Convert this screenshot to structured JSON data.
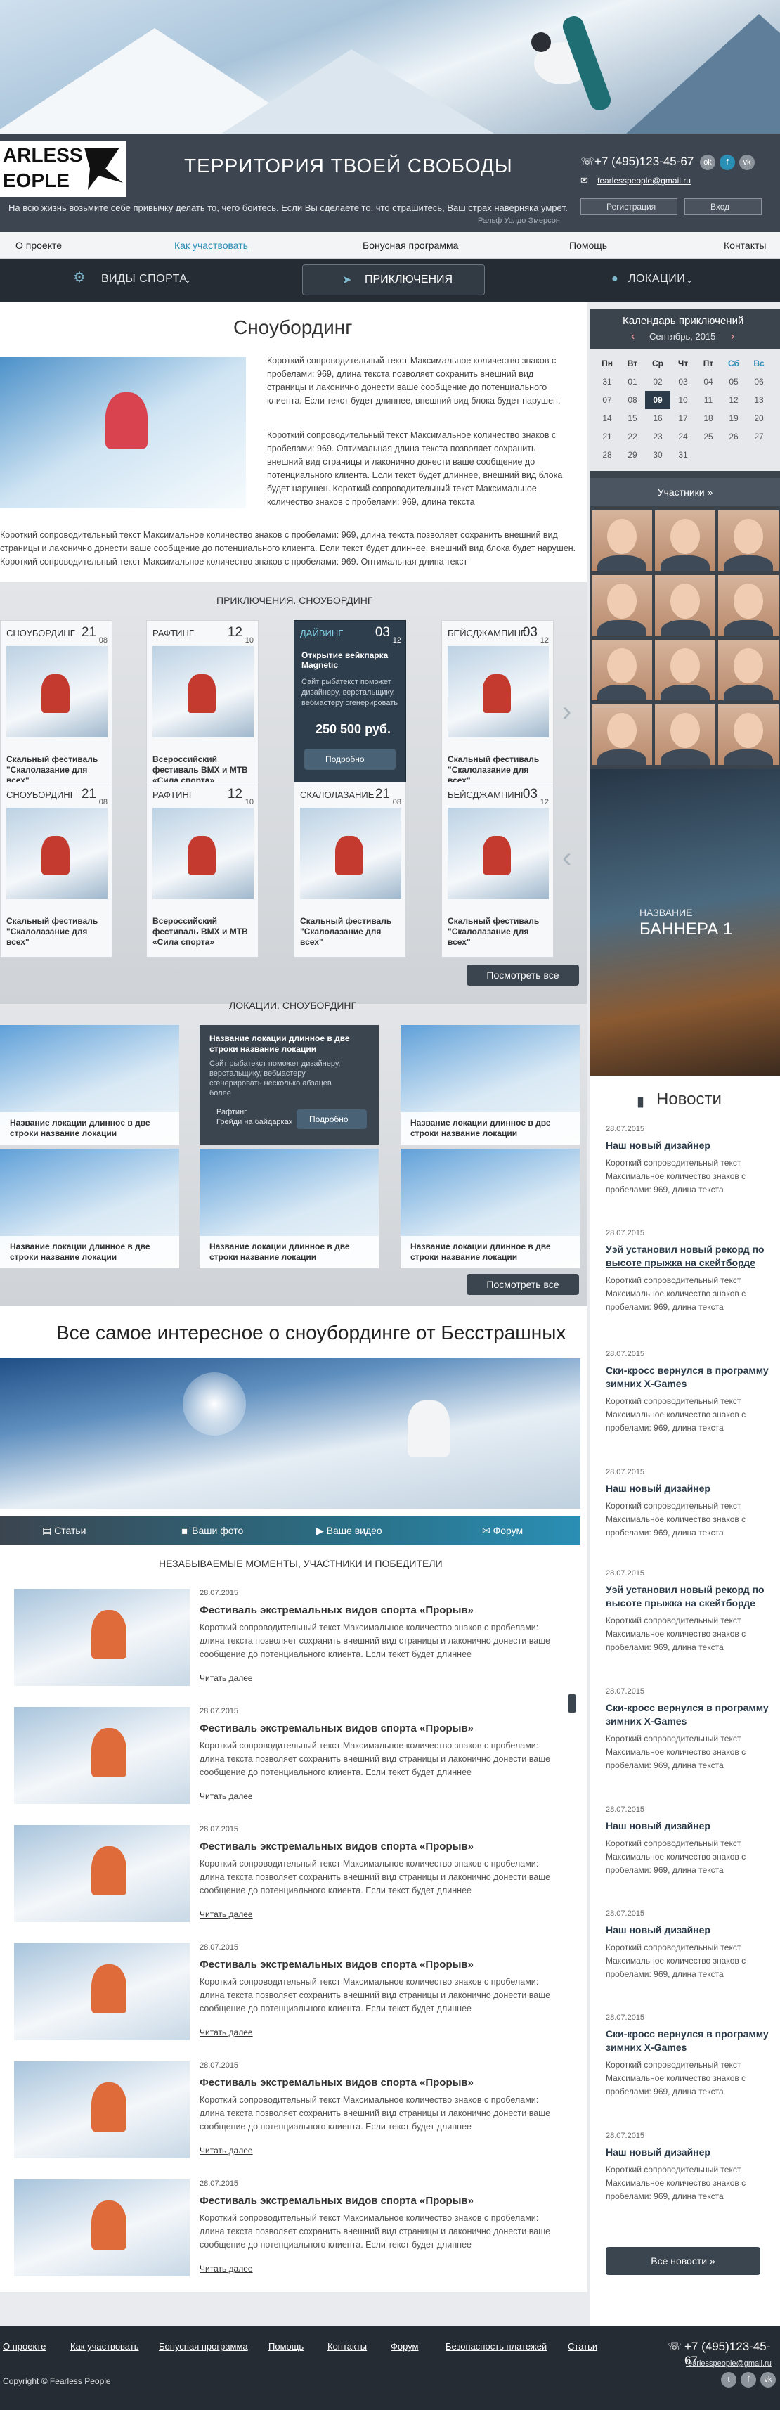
{
  "header": {
    "logo_text": "FEARLESS PEOPLE",
    "slogan": "ТЕРРИТОРИЯ ТВОЕЙ СВОБОДЫ",
    "quote": "На всю жизнь возьмите себе привычку делать то, чего боитесь. Если Вы сделаете то, что страшитесь, Ваш страх наверняка умрёт.",
    "quote_author": "Ральф Уолдо Эмерсон",
    "phone": "+7 (495)123-45-67",
    "email": "fearlesspeople@gmail.ru",
    "register_label": "Регистрация",
    "login_label": "Вход",
    "social": [
      "ok",
      "f",
      "vk"
    ]
  },
  "topnav": [
    "О проекте",
    "Как участвовать",
    "Бонусная программа",
    "Помощь",
    "Контакты"
  ],
  "mainnav": {
    "sports": "ВИДЫ СПОРТА",
    "adventures": "ПРИКЛЮЧЕНИЯ",
    "locations": "ЛОКАЦИИ"
  },
  "intro": {
    "title": "Сноубординг",
    "p1": "Короткий сопроводительный текст Максимальное количество знаков с пробелами: 969, длина текста позволяет сохранить внешний вид страницы и лаконично донести ваше сообщение до потенциального клиента. Если текст будет длиннее, внешний вид блока будет нарушен.",
    "p2": "Короткий сопроводительный текст Максимальное количество знаков с пробелами: 969. Оптимальная длина текста позволяет сохранить внешний вид страницы и лаконично донести ваше сообщение до потенциального клиента. Если текст будет длиннее, внешний вид блока будет нарушен. Короткий сопроводительный текст Максимальное количество знаков с пробелами: 969, длина текста",
    "p3": "Короткий сопроводительный текст Максимальное количество знаков с пробелами: 969, длина текста позволяет сохранить внешний вид страницы и лаконично донести ваше сообщение до потенциального клиента. Если текст будет длиннее, внешний вид блока будет нарушен. Короткий сопроводительный текст Максимальное количество знаков с пробелами: 969. Оптимальная длина текст"
  },
  "adventures": {
    "heading": "ПРИКЛЮЧЕНИЯ. СНОУБОРДИНГ",
    "row1": [
      {
        "cat": "СНОУБОРДИНГ",
        "d1": "21",
        "d2": "08",
        "text": "Скальный фестиваль \"Скалолазание для всех\""
      },
      {
        "cat": "РАФТИНГ",
        "d1": "12",
        "d2": "10",
        "text": "Всероссийский фестиваль ВМХ и МТВ «Сила спорта»"
      },
      {
        "cat": "ДАЙВИНГ",
        "d1": "03",
        "d2": "12",
        "title": "Открытие вейкпарка Magnetic",
        "text": "Сайт рыбатекст поможет дизайнеру, верстальщику, вебмастеру сгенерировать",
        "price": "250 500 руб.",
        "btn": "Подробно"
      },
      {
        "cat": "БЕЙСДЖАМПИНГ",
        "d1": "03",
        "d2": "12",
        "text": "Скальный фестиваль \"Скалолазание для всех\""
      }
    ],
    "row2": [
      {
        "cat": "СНОУБОРДИНГ",
        "d1": "21",
        "d2": "08",
        "text": "Скальный фестиваль \"Скалолазание для всех\""
      },
      {
        "cat": "РАФТИНГ",
        "d1": "12",
        "d2": "10",
        "text": "Всероссийский фестиваль ВМХ и МТВ «Сила спорта»"
      },
      {
        "cat": "СКАЛОЛАЗАНИЕ",
        "d1": "21",
        "d2": "08",
        "text": "Скальный фестиваль \"Скалолазание для всех\""
      },
      {
        "cat": "БЕЙСДЖАМПИНГ",
        "d1": "03",
        "d2": "12",
        "text": "Скальный фестиваль \"Скалолазание для всех\""
      }
    ],
    "view_all": "Посмотреть все"
  },
  "locations": {
    "heading": "ЛОКАЦИИ. СНОУБОРДИНГ",
    "items": [
      "Название локации длинное в две строки название локации",
      "Название локации длинное в две строки название локации",
      "Название локации длинное в две строки название локации",
      "Название локации длинное в две строки название локации",
      "Название локации длинное в две строки название локации",
      "Название локации длинное в две строки название локации"
    ],
    "hover": {
      "title": "Название локации длинное в две строки название локации",
      "text": "Сайт рыбатекст поможет дизайнеру, верстальщику, вебмастеру сгенерировать несколько абзацев более",
      "tag1": "Рафтинг",
      "tag2": "Грейди на байдарках",
      "btn": "Подробно"
    },
    "view_all": "Посмотреть все"
  },
  "interesting": {
    "title": "Все самое интересное о сноубординге от Бесстрашных"
  },
  "tabs": [
    "Статьи",
    "Ваши фото",
    "Ваше видео",
    "Форум"
  ],
  "moments": {
    "heading": "НЕЗАБЫВАЕМЫЕ МОМЕНТЫ, УЧАСТНИКИ И ПОБЕДИТЕЛИ",
    "date": "28.07.2015",
    "title": "Фестиваль экстремальных видов спорта «Прорыв»",
    "text": "Короткий сопроводительный текст Максимальное количество знаков с пробелами: длина текста позволяет сохранить внешний вид страницы и лаконично донести ваше сообщение до потенциального клиента. Если текст будет длиннее",
    "more": "Читать далее",
    "count": 6
  },
  "calendar": {
    "title": "Календарь приключений",
    "month": "Сентябрь, 2015",
    "days": [
      "Пн",
      "Вт",
      "Ср",
      "Чт",
      "Пт",
      "Сб",
      "Вс"
    ],
    "weeks": [
      [
        "31",
        "01",
        "02",
        "03",
        "04",
        "05",
        "06"
      ],
      [
        "07",
        "08",
        "09",
        "10",
        "11",
        "12",
        "13"
      ],
      [
        "14",
        "15",
        "16",
        "17",
        "18",
        "19",
        "20"
      ],
      [
        "21",
        "22",
        "23",
        "24",
        "25",
        "26",
        "27"
      ],
      [
        "28",
        "29",
        "30",
        "31",
        "",
        "",
        ""
      ]
    ],
    "participants": "Участники"
  },
  "banner": {
    "sub": "НАЗВАНИЕ",
    "title": "БАННЕРА 1"
  },
  "news": {
    "heading": "Новости",
    "items": [
      {
        "date": "28.07.2015",
        "title": "Наш новый дизайнер"
      },
      {
        "date": "28.07.2015",
        "title": "Уэй установил новый рекорд по высоте прыжка на скейтборде"
      },
      {
        "date": "28.07.2015",
        "title": "Ски-кросс вернулся в программу зимних X-Games"
      },
      {
        "date": "28.07.2015",
        "title": "Наш новый дизайнер"
      },
      {
        "date": "28.07.2015",
        "title": "Уэй установил новый рекорд по высоте прыжка на скейтборде"
      },
      {
        "date": "28.07.2015",
        "title": "Ски-кросс вернулся в программу зимних X-Games"
      },
      {
        "date": "28.07.2015",
        "title": "Наш новый дизайнер"
      },
      {
        "date": "28.07.2015",
        "title": "Наш новый дизайнер"
      },
      {
        "date": "28.07.2015",
        "title": "Ски-кросс вернулся в программу зимних X-Games"
      },
      {
        "date": "28.07.2015",
        "title": "Наш новый дизайнер"
      }
    ],
    "text": "Короткий сопроводительный текст Максимальное количество знаков с пробелами: 969, длина текста",
    "all": "Все новости"
  },
  "footer": {
    "links": [
      "О проекте",
      "Как участвовать",
      "Бонусная программа",
      "Помощь",
      "Контакты",
      "Форум",
      "Безопасность платежей",
      "Статьи"
    ],
    "phone": "+7 (495)123-45-67",
    "email": "fearlesspeople@gmail.ru",
    "copyright": "Copyright © Fearless People"
  },
  "colors": {
    "dark": "#262c33",
    "accent": "#2a8fb5",
    "panel": "#3b434c"
  }
}
